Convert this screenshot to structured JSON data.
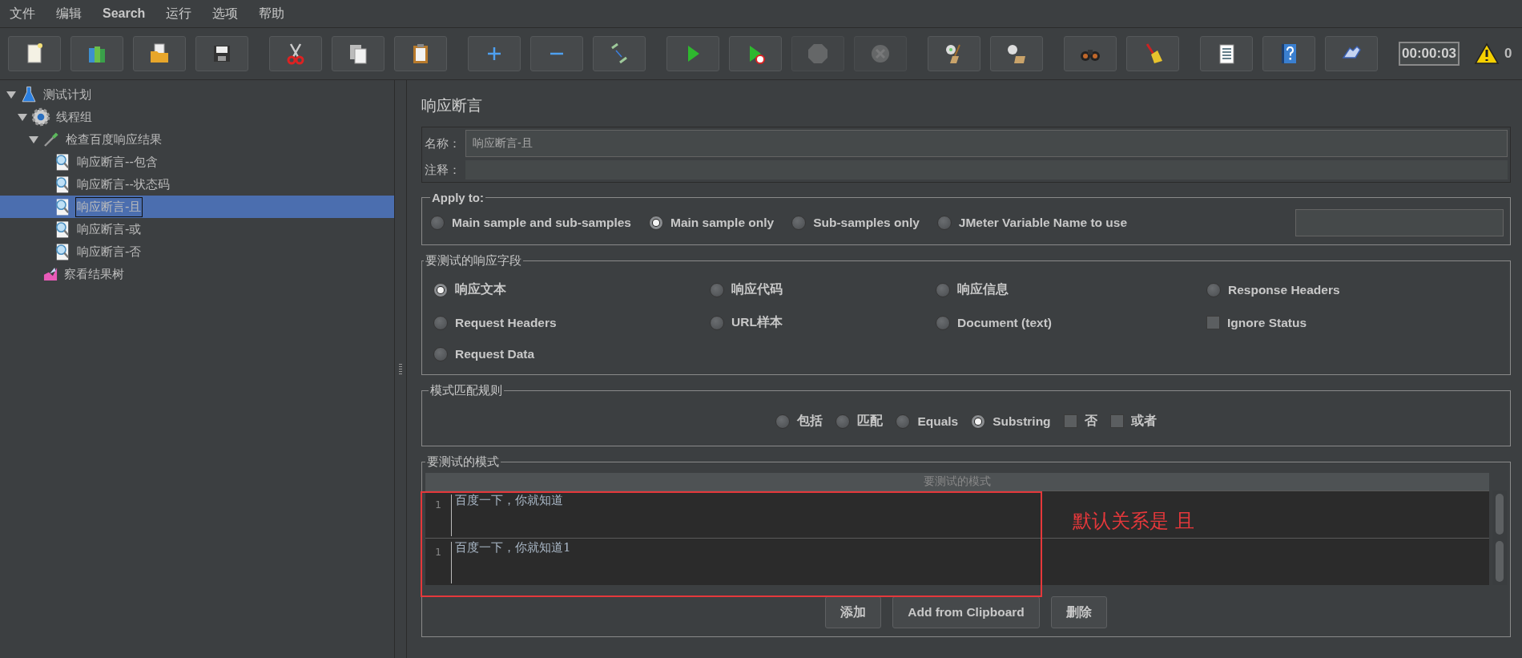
{
  "menu": [
    "文件",
    "编辑",
    "Search",
    "运行",
    "选项",
    "帮助"
  ],
  "toolbar": {
    "groups": [
      [
        {
          "kind": "new",
          "disabled": false
        },
        {
          "kind": "templates",
          "disabled": false
        },
        {
          "kind": "open",
          "disabled": false
        },
        {
          "kind": "save",
          "disabled": false
        }
      ],
      [
        {
          "kind": "cut",
          "disabled": false
        },
        {
          "kind": "copy",
          "disabled": false
        },
        {
          "kind": "paste",
          "disabled": false
        }
      ],
      [
        {
          "kind": "expand",
          "disabled": false
        },
        {
          "kind": "collapse",
          "disabled": false
        },
        {
          "kind": "toggle",
          "disabled": false
        }
      ],
      [
        {
          "kind": "start",
          "disabled": false
        },
        {
          "kind": "start_no_pause",
          "disabled": false
        },
        {
          "kind": "stop",
          "disabled": true
        },
        {
          "kind": "shutdown",
          "disabled": true
        }
      ],
      [
        {
          "kind": "clear",
          "disabled": false
        },
        {
          "kind": "clear_all",
          "disabled": false
        }
      ],
      [
        {
          "kind": "search",
          "disabled": false
        },
        {
          "kind": "reset_search",
          "disabled": false
        }
      ],
      [
        {
          "kind": "functions",
          "disabled": false
        },
        {
          "kind": "help",
          "disabled": false
        },
        {
          "kind": "remote",
          "disabled": false
        }
      ]
    ],
    "timer": "00:00:03",
    "warnings": "0"
  },
  "tree": [
    {
      "label": "测试计划",
      "kind": "plan",
      "selected": false,
      "expanded": true,
      "children": [
        {
          "label": "线程组",
          "kind": "threads",
          "selected": false,
          "expanded": true,
          "children": [
            {
              "label": "检查百度响应结果",
              "kind": "sampler",
              "selected": false,
              "expanded": true,
              "children": [
                {
                  "label": "响应断言--包含",
                  "kind": "assertion",
                  "selected": false
                },
                {
                  "label": "响应断言--状态码",
                  "kind": "assertion",
                  "selected": false
                },
                {
                  "label": "响应断言-且",
                  "kind": "assertion",
                  "selected": true
                },
                {
                  "label": "响应断言-或",
                  "kind": "assertion",
                  "selected": false
                },
                {
                  "label": "响应断言-否",
                  "kind": "assertion",
                  "selected": false
                }
              ]
            },
            {
              "label": "察看结果树",
              "kind": "listener",
              "selected": false
            }
          ]
        }
      ]
    }
  ],
  "panel": {
    "title": "响应断言",
    "name_label": "名称：",
    "name_value": "响应断言-且",
    "comment_label": "注释：",
    "apply_to": {
      "title": "Apply to:",
      "options": [
        {
          "label": "Main sample and sub-samples",
          "selected": false
        },
        {
          "label": "Main sample only",
          "selected": true
        },
        {
          "label": "Sub-samples only",
          "selected": false
        },
        {
          "label": "JMeter Variable Name to use",
          "selected": false
        }
      ]
    },
    "response_field": {
      "title": "要测试的响应字段",
      "options": [
        {
          "label": "响应文本",
          "kind": "radio",
          "selected": true
        },
        {
          "label": "响应代码",
          "kind": "radio",
          "selected": false
        },
        {
          "label": "响应信息",
          "kind": "radio",
          "selected": false
        },
        {
          "label": "Response Headers",
          "kind": "radio",
          "selected": false
        },
        {
          "label": "Request Headers",
          "kind": "radio",
          "selected": false
        },
        {
          "label": "URL样本",
          "kind": "radio",
          "selected": false
        },
        {
          "label": "Document (text)",
          "kind": "radio",
          "selected": false
        },
        {
          "label": "Ignore Status",
          "kind": "checkbox",
          "checked": false
        },
        {
          "label": "Request Data",
          "kind": "radio",
          "selected": false
        }
      ]
    },
    "matching": {
      "title": "模式匹配规则",
      "options": [
        {
          "label": "包括",
          "kind": "radio",
          "selected": false
        },
        {
          "label": "匹配",
          "kind": "radio",
          "selected": false
        },
        {
          "label": "Equals",
          "kind": "radio",
          "selected": false
        },
        {
          "label": "Substring",
          "kind": "radio",
          "selected": true
        },
        {
          "label": "否",
          "kind": "checkbox",
          "checked": false
        },
        {
          "label": "或者",
          "kind": "checkbox",
          "checked": false
        }
      ]
    },
    "patterns": {
      "title": "要测试的模式",
      "header": "要测试的模式",
      "rows": [
        {
          "line": "1",
          "text": "百度一下，你就知道"
        },
        {
          "line": "1",
          "text": "百度一下，你就知道1"
        }
      ],
      "buttons": [
        "添加",
        "Add from Clipboard",
        "删除"
      ],
      "annotation": "默认关系是 且"
    }
  }
}
